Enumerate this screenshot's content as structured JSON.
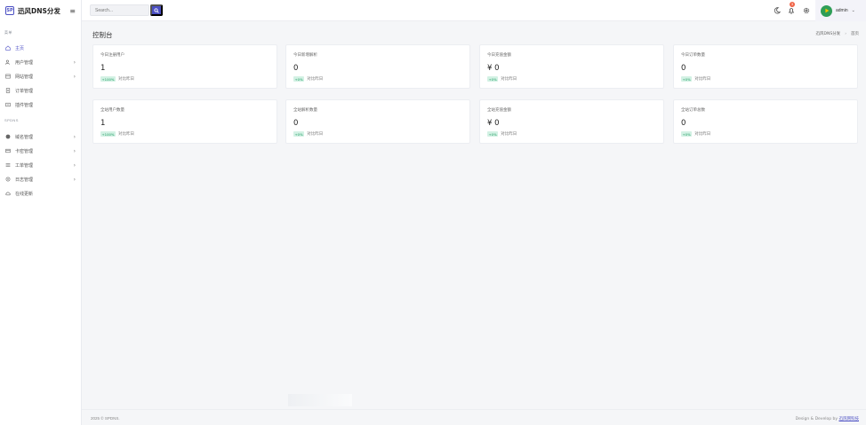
{
  "brand": {
    "logo_text": "SP",
    "name": "迅风DNS分发"
  },
  "sidebar": {
    "section1": "菜单",
    "items1": [
      {
        "label": "主页",
        "icon": "home-icon",
        "arrow": ""
      },
      {
        "label": "用户管理",
        "icon": "users-icon",
        "arrow": "›"
      },
      {
        "label": "网站管理",
        "icon": "website-icon",
        "arrow": "›"
      },
      {
        "label": "订单管理",
        "icon": "order-icon",
        "arrow": ""
      },
      {
        "label": "插件管理",
        "icon": "plugin-icon",
        "arrow": ""
      }
    ],
    "section2": "SPDNS",
    "items2": [
      {
        "label": "域名管理",
        "icon": "domain-icon",
        "arrow": "›"
      },
      {
        "label": "卡密管理",
        "icon": "card-icon",
        "arrow": "›"
      },
      {
        "label": "工单管理",
        "icon": "ticket-icon",
        "arrow": "›"
      },
      {
        "label": "日志管理",
        "icon": "log-icon",
        "arrow": "›"
      },
      {
        "label": "在线更新",
        "icon": "cloud-icon",
        "arrow": ""
      }
    ]
  },
  "topbar": {
    "search_placeholder": "Search...",
    "notification_count": "3",
    "username": "admin",
    "caret": "⌄"
  },
  "page": {
    "title": "控制台",
    "breadcrumb": [
      "迅风DNS分发",
      "首页"
    ],
    "breadcrumb_sep": "›"
  },
  "cards": [
    {
      "label": "今日注册用户",
      "value": "1",
      "pct": "+100%",
      "compare": "对比昨日"
    },
    {
      "label": "今日新增解析",
      "value": "0",
      "pct": "+0%",
      "compare": "对比昨日"
    },
    {
      "label": "今日充值金额",
      "value": "¥ 0",
      "pct": "+0%",
      "compare": "对比昨日"
    },
    {
      "label": "今日订单数量",
      "value": "0",
      "pct": "+0%",
      "compare": "对比昨日"
    },
    {
      "label": "全站用户数量",
      "value": "1",
      "pct": "+100%",
      "compare": "对比昨日"
    },
    {
      "label": "全站解析数量",
      "value": "0",
      "pct": "+0%",
      "compare": "对比昨日"
    },
    {
      "label": "全站充值金额",
      "value": "¥ 0",
      "pct": "+0%",
      "compare": "对比昨日"
    },
    {
      "label": "全站订单总数",
      "value": "0",
      "pct": "+0%",
      "compare": "对比昨日"
    }
  ],
  "footer": {
    "copyright": "2025 © SPDNS.",
    "design_text": "Design & Develop by",
    "design_link": "迅风网科技"
  },
  "colors": {
    "accent": "#4b4fc3",
    "badge": "#f06548",
    "success": "#1f9d63"
  }
}
